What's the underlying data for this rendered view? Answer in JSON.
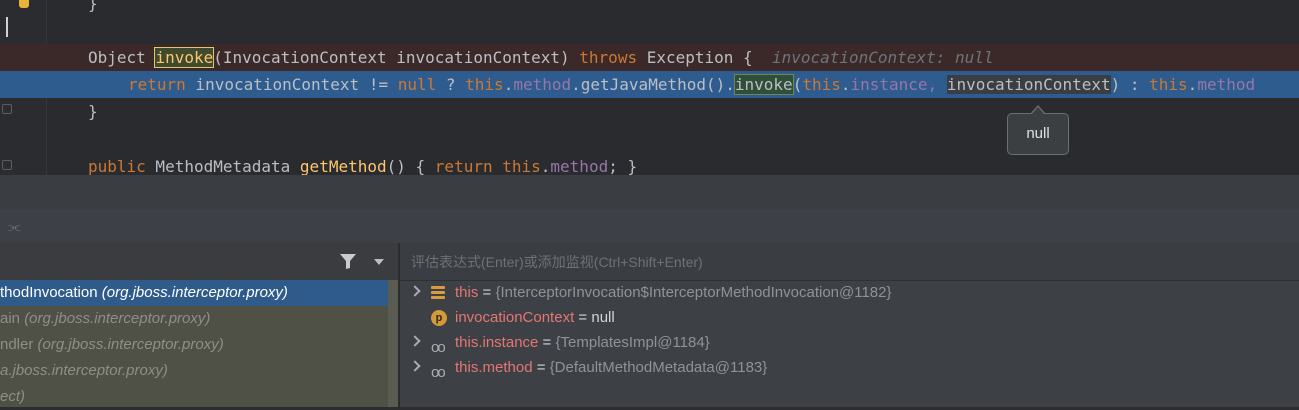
{
  "editor": {
    "line_closing_brace_top": "}",
    "method_decl": {
      "prefix": "Object ",
      "name": "invoke",
      "params": "(InvocationContext invocationContext) ",
      "throws_kw": "throws",
      "exception": " Exception {",
      "inline_hint": "invocationContext: null"
    },
    "return_line": {
      "return_kw": "return",
      "p1": " invocationContext != ",
      "null_kw": "null",
      "p2": " ? ",
      "this1": "this",
      "dot1": ".",
      "method1": "method",
      "p3": ".getJavaMethod().",
      "invoke": "invoke",
      "p4": "(",
      "this2": "this",
      "dot2": ".",
      "instance": "instance,",
      "p5": " ",
      "ctx_arg": "invocationContext",
      "p6": ") : ",
      "this3": "this",
      "dot3": ".",
      "method3": "method"
    },
    "closing_brace": "}",
    "getter_line": {
      "public_kw": "public",
      "type": " MethodMetadata ",
      "name": "getMethod",
      "p1": "() { ",
      "return_kw": "return",
      "p2": " ",
      "this_kw": "this",
      "dot": ".",
      "field": "method",
      "p3": "; }"
    },
    "tooltip_text": "null"
  },
  "frames": {
    "items": [
      {
        "method": "thodInvocation ",
        "pkg": "(org.jboss.interceptor.proxy)",
        "selected": true
      },
      {
        "method": "ain ",
        "pkg": "(org.jboss.interceptor.proxy)",
        "selected": false
      },
      {
        "method": "ndler ",
        "pkg": "(org.jboss.interceptor.proxy)",
        "selected": false
      },
      {
        "method": "",
        "pkg": "a.jboss.interceptor.proxy)",
        "selected": false
      },
      {
        "method": "",
        "pkg": "ect)",
        "selected": false
      }
    ]
  },
  "variables": {
    "eval_placeholder": "评估表达式(Enter)或添加监视(Ctrl+Shift+Enter)",
    "items": [
      {
        "name": "this",
        "eq": " = ",
        "value": "{InterceptorInvocation$InterceptorMethodInvocation@1182}",
        "icon": "field-stack-icon",
        "expandable": true
      },
      {
        "name": "invocationContext",
        "eq": " = ",
        "value": "null",
        "icon": "parameter-icon",
        "expandable": false
      },
      {
        "name": "this.instance",
        "eq": " = ",
        "value": "{TemplatesImpl@1184}",
        "icon": "watch-glasses-icon",
        "expandable": true
      },
      {
        "name": "this.method",
        "eq": " = ",
        "value": "{DefaultMethodMetadata@1183}",
        "icon": "watch-glasses-icon",
        "expandable": true
      }
    ]
  },
  "colors": {
    "accent_selection": "#2f5b8a",
    "keyword": "#cc7832",
    "field": "#9876aa",
    "variable_name": "#e37774"
  }
}
